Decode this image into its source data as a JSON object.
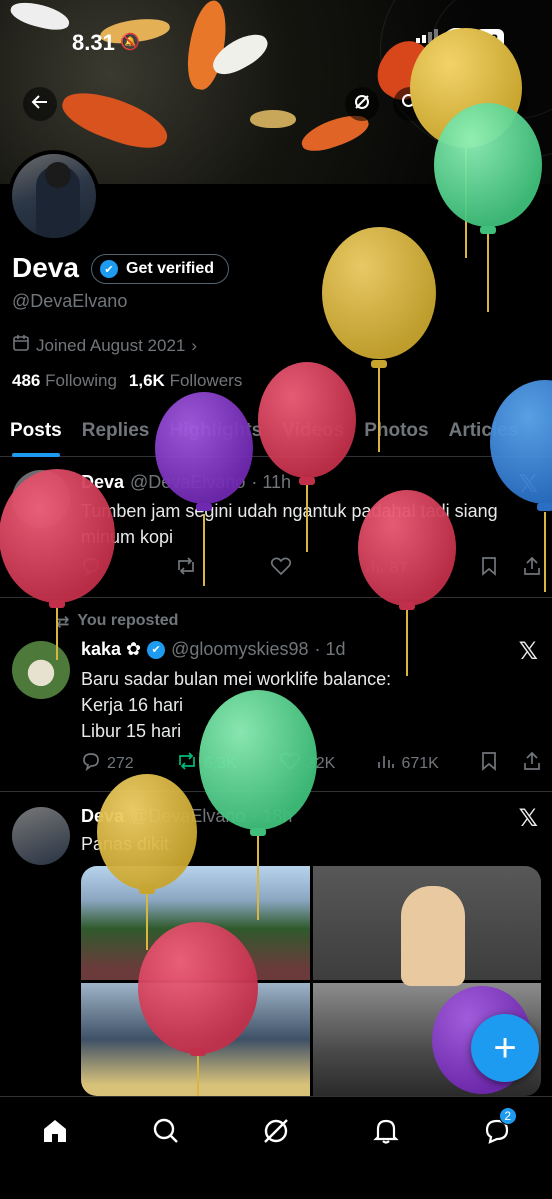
{
  "status": {
    "time": "8.31",
    "battery": "78"
  },
  "profile": {
    "name": "Deva",
    "verify_label": "Get verified",
    "handle": "@DevaElvano",
    "joined": "Joined August 2021",
    "following_count": "486",
    "following_label": "Following",
    "followers_count": "1,6K",
    "followers_label": "Followers"
  },
  "tabs": [
    "Posts",
    "Replies",
    "Highlights",
    "Videos",
    "Photos",
    "Articles"
  ],
  "posts": [
    {
      "name": "Deva",
      "handle": "@DevaElvano",
      "time": "· 11h",
      "text": "Tumben jam segini udah ngantuk padahal tadi siang minum kopi",
      "views": "87"
    },
    {
      "repost_label": "You reposted",
      "name": "kaka ✿",
      "handle": "@gloomyskies98",
      "time": "· 1d",
      "text_lines": [
        "Baru sadar bulan mei worklife balance:",
        "Kerja 16 hari",
        "Libur 15 hari"
      ],
      "replies": "272",
      "reposts": "6,3K",
      "likes": "32K",
      "views": "671K"
    },
    {
      "name": "Deva",
      "handle": "@DevaElvano",
      "time": "· 18h",
      "text": "Panas dikit"
    }
  ],
  "nav": {
    "messages_badge": "2"
  },
  "colors": {
    "accent": "#1d9bf0",
    "repost": "#00ba7c",
    "muted": "#71767b"
  },
  "icons": [
    "back-arrow-icon",
    "grok-icon",
    "search-icon",
    "edit-icon",
    "share-icon",
    "verified-icon",
    "calendar-icon",
    "chevron-right-icon",
    "x-logo-icon",
    "reply-icon",
    "retweet-icon",
    "like-icon",
    "views-icon",
    "bookmark-icon",
    "share-icon",
    "home-icon",
    "search-icon",
    "grok-icon",
    "bell-icon",
    "messages-icon",
    "compose-plus-icon",
    "balloon-icon"
  ]
}
